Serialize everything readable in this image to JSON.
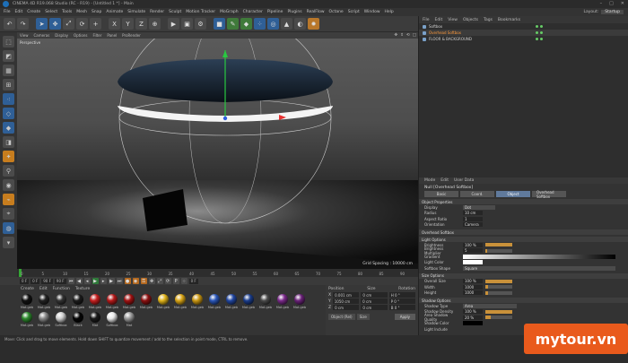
{
  "window": {
    "title": "CINEMA 4D R19.068 Studio (RC - R19) - [Untitled 1 *] - Main"
  },
  "menubar": {
    "items": [
      "File",
      "Edit",
      "Create",
      "Select",
      "Tools",
      "Mesh",
      "Snap",
      "Animate",
      "Simulate",
      "Render",
      "Sculpt",
      "Motion Tracker",
      "MoGraph",
      "Character",
      "Pipeline",
      "Plugins",
      "RealFlow",
      "Octane",
      "Script",
      "Window",
      "Help"
    ]
  },
  "layout": {
    "label": "Layout:",
    "value": "Startup"
  },
  "viewport": {
    "menu": [
      "View",
      "Cameras",
      "Display",
      "Options",
      "Filter",
      "Panel",
      "ProRender"
    ],
    "label": "Perspective",
    "grid_spacing": "Grid Spacing : 10000 cm"
  },
  "timeline": {
    "ticks": [
      "0",
      "5",
      "10",
      "15",
      "20",
      "25",
      "30",
      "35",
      "40",
      "45",
      "50",
      "55",
      "60",
      "65",
      "70",
      "75",
      "80",
      "85",
      "90"
    ],
    "frame_end": "0 F",
    "field_start": "0 F",
    "field_cur": "0 F",
    "field_end": "90 F",
    "field_max": "90 F"
  },
  "materials": {
    "menu": [
      "Create",
      "Edit",
      "Function",
      "Texture"
    ],
    "items": [
      {
        "label": "Mat.geb",
        "color": "#111"
      },
      {
        "label": "Mat.geb",
        "color": "#222"
      },
      {
        "label": "Mat.geb",
        "color": "#333"
      },
      {
        "label": "Mat.geb",
        "color": "#1c1c1c"
      },
      {
        "label": "Mat.geb",
        "color": "#c61f1f"
      },
      {
        "label": "Mat.geb",
        "color": "#b51a1a"
      },
      {
        "label": "Mat.geb",
        "color": "#a01212"
      },
      {
        "label": "Mat.geb",
        "color": "#8a1010"
      },
      {
        "label": "Mat.geb",
        "color": "#e0b31a"
      },
      {
        "label": "Mat.geb",
        "color": "#d9a516"
      },
      {
        "label": "Mat.geb",
        "color": "#c99612"
      },
      {
        "label": "Mat.geb",
        "color": "#2a56b8"
      },
      {
        "label": "Mat.geb",
        "color": "#2146a0"
      },
      {
        "label": "Mat.geb",
        "color": "#1a3c8a"
      },
      {
        "label": "Mat.geb",
        "color": "#4a4a4a"
      },
      {
        "label": "Mat.geb",
        "color": "#7a2a8a"
      },
      {
        "label": "Mat.geb",
        "color": "#6a2278"
      },
      {
        "label": "Mat.geb",
        "color": "#2d8a2d"
      },
      {
        "label": "Mat.geb",
        "color": "#888"
      },
      {
        "label": "Softbox",
        "color": "#cfcfcf"
      },
      {
        "label": "Black",
        "color": "#050505"
      },
      {
        "label": "Mat",
        "color": "#1a1a1a"
      },
      {
        "label": "Softbox",
        "color": "#e8e8e8"
      },
      {
        "label": "Mat",
        "color": "#9a9a9a"
      }
    ]
  },
  "coords": {
    "headers": [
      "Position",
      "Size",
      "Rotation"
    ],
    "rows": [
      {
        "axis": "X",
        "pos": "0.001 cm",
        "size": "0 cm",
        "rot": "H 0 °"
      },
      {
        "axis": "Y",
        "pos": "1050 cm",
        "size": "0 cm",
        "rot": "P 0 °"
      },
      {
        "axis": "Z",
        "pos": "0 cm",
        "size": "0 cm",
        "rot": "B 0 °"
      }
    ],
    "mode": "Object (Rel)",
    "size_mode": "Size",
    "apply": "Apply"
  },
  "status": {
    "text": "Move: Click and drag to move elements. Hold down SHIFT to quantize movement / add to the selection in point mode, CTRL to remove."
  },
  "object_manager": {
    "menu": [
      "File",
      "Edit",
      "View",
      "Objects",
      "Tags",
      "Bookmarks"
    ],
    "objects": [
      "Softbox",
      "Overhead Softbox",
      "FLOOR & BACKGROUND"
    ]
  },
  "attributes": {
    "menu": [
      "Mode",
      "Edit",
      "User Data"
    ],
    "title": "Null [Overhead Softbox]",
    "tabs": [
      "Basic",
      "Coord.",
      "Object",
      "Overhead Softbox"
    ],
    "sections": {
      "object_props": "Object Properties",
      "overhead": "Overhead Softbox",
      "light": "Light Options",
      "size": "Size Options",
      "shadow": "Shadow Options"
    },
    "props": {
      "display": {
        "label": "Display",
        "value": "Dot"
      },
      "radius": {
        "label": "Radius",
        "value": "10 cm"
      },
      "aspect": {
        "label": "Aspect Ratio",
        "value": "1"
      },
      "orient": {
        "label": "Orientation",
        "value": "Camera"
      },
      "brightness": {
        "label": "Brightness",
        "value": "100 %"
      },
      "multiplier": {
        "label": "Brightness Multiplier",
        "value": "5"
      },
      "gradient": {
        "label": "Gradient"
      },
      "lightcolor": {
        "label": "Light Color"
      },
      "shape": {
        "label": "Softbox Shape",
        "value": "Square"
      },
      "overall": {
        "label": "Overall Size",
        "value": "100 %"
      },
      "width": {
        "label": "Width",
        "value": "1000"
      },
      "height": {
        "label": "Height",
        "value": "1000"
      },
      "shadowtype": {
        "label": "Shadow Type",
        "value": "Area"
      },
      "density": {
        "label": "Shadow Density",
        "value": "100 %"
      },
      "areaq": {
        "label": "Area Shadow Quality",
        "value": "20 %"
      },
      "scolor": {
        "label": "Shadow Color"
      },
      "include": {
        "label": "Light Include"
      }
    },
    "levels": {
      "brightness": 1.0,
      "multiplier": 0.05,
      "overall": 1.0,
      "width": 0.1,
      "height": 0.1,
      "density": 1.0,
      "areaq": 0.2
    }
  },
  "watermark": {
    "text": "mytour.vn"
  },
  "colors": {
    "accent": "#c9913a",
    "brand": "#e95a1c"
  }
}
